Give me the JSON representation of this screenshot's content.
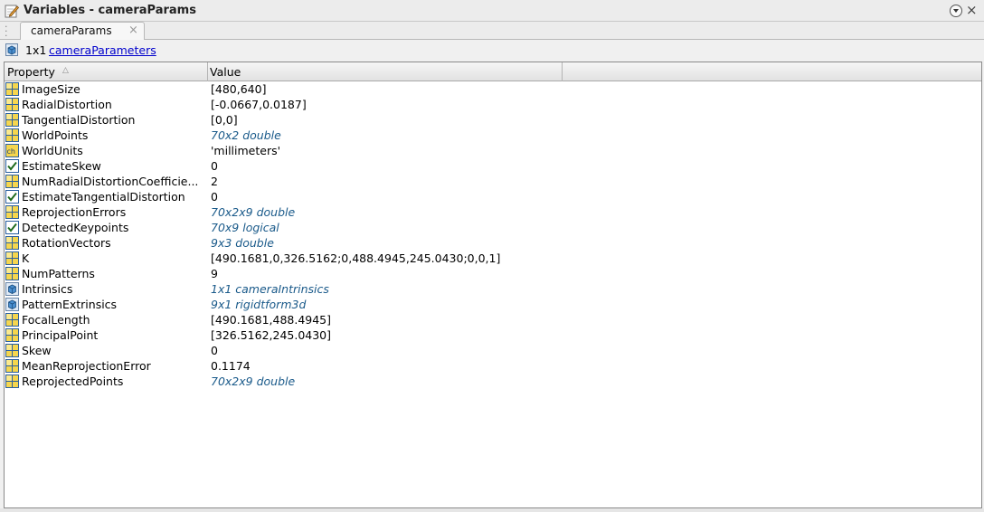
{
  "window": {
    "title": "Variables - cameraParams",
    "close_glyph": "×"
  },
  "tabs": [
    {
      "label": "cameraParams",
      "close_glyph": "×"
    }
  ],
  "info": {
    "size": "1x1",
    "class_name": "cameraParameters"
  },
  "table": {
    "columns": [
      "Property",
      "Value",
      ""
    ],
    "rows": [
      {
        "icon": "grid-icon",
        "name": "ImageSize",
        "value": "[480,640]",
        "link": false
      },
      {
        "icon": "grid-icon",
        "name": "RadialDistortion",
        "value": "[-0.0667,0.0187]",
        "link": false
      },
      {
        "icon": "grid-icon",
        "name": "TangentialDistortion",
        "value": "[0,0]",
        "link": false
      },
      {
        "icon": "grid-icon",
        "name": "WorldPoints",
        "value": "70x2 double",
        "link": true
      },
      {
        "icon": "char-icon",
        "name": "WorldUnits",
        "value": "'millimeters'",
        "link": false
      },
      {
        "icon": "checkbox-icon",
        "name": "EstimateSkew",
        "value": "0",
        "link": false
      },
      {
        "icon": "grid-icon",
        "name": "NumRadialDistortionCoefficie...",
        "value": "2",
        "link": false
      },
      {
        "icon": "checkbox-icon",
        "name": "EstimateTangentialDistortion",
        "value": "0",
        "link": false
      },
      {
        "icon": "grid-icon",
        "name": "ReprojectionErrors",
        "value": "70x2x9 double",
        "link": true
      },
      {
        "icon": "checkbox-icon",
        "name": "DetectedKeypoints",
        "value": "70x9 logical",
        "link": true
      },
      {
        "icon": "grid-icon",
        "name": "RotationVectors",
        "value": "9x3 double",
        "link": true
      },
      {
        "icon": "grid-icon",
        "name": "K",
        "value": "[490.1681,0,326.5162;0,488.4945,245.0430;0,0,1]",
        "link": false
      },
      {
        "icon": "grid-icon",
        "name": "NumPatterns",
        "value": "9",
        "link": false
      },
      {
        "icon": "object-icon",
        "name": "Intrinsics",
        "value": "1x1 cameraIntrinsics",
        "link": true
      },
      {
        "icon": "object-icon",
        "name": "PatternExtrinsics",
        "value": "9x1 rigidtform3d",
        "link": true
      },
      {
        "icon": "grid-icon",
        "name": "FocalLength",
        "value": "[490.1681,488.4945]",
        "link": false
      },
      {
        "icon": "grid-icon",
        "name": "PrincipalPoint",
        "value": "[326.5162,245.0430]",
        "link": false
      },
      {
        "icon": "grid-icon",
        "name": "Skew",
        "value": "0",
        "link": false
      },
      {
        "icon": "grid-icon",
        "name": "MeanReprojectionError",
        "value": "0.1174",
        "link": false
      },
      {
        "icon": "grid-icon",
        "name": "ReprojectedPoints",
        "value": "70x2x9 double",
        "link": true
      }
    ]
  },
  "colors": {
    "link_value": "#1a5a8a",
    "class_link": "#0000cc",
    "grid_icon_fill": "#f5d64e",
    "grid_icon_line": "#2a5f9e"
  }
}
